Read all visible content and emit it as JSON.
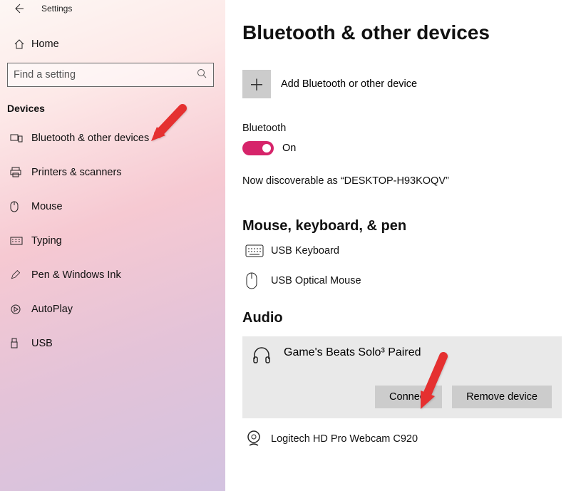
{
  "app_title": "Settings",
  "home_label": "Home",
  "search_placeholder": "Find a setting",
  "section_title": "Devices",
  "nav_items": [
    {
      "label": "Bluetooth & other devices"
    },
    {
      "label": "Printers & scanners"
    },
    {
      "label": "Mouse"
    },
    {
      "label": "Typing"
    },
    {
      "label": "Pen & Windows Ink"
    },
    {
      "label": "AutoPlay"
    },
    {
      "label": "USB"
    }
  ],
  "page_title": "Bluetooth & other devices",
  "add_device_label": "Add Bluetooth or other device",
  "bluetooth_label": "Bluetooth",
  "toggle_state_label": "On",
  "discoverable_text": "Now discoverable as “DESKTOP-H93KOQV”",
  "group_mouse_title": "Mouse, keyboard, & pen",
  "device_keyboard": "USB Keyboard",
  "device_mouse_opt": "USB Optical Mouse",
  "group_audio_title": "Audio",
  "audio_device": {
    "name": "Game's Beats Solo³",
    "status": "Paired",
    "connect_label": "Connect",
    "remove_label": "Remove device"
  },
  "device_webcam": "Logitech HD Pro Webcam C920"
}
